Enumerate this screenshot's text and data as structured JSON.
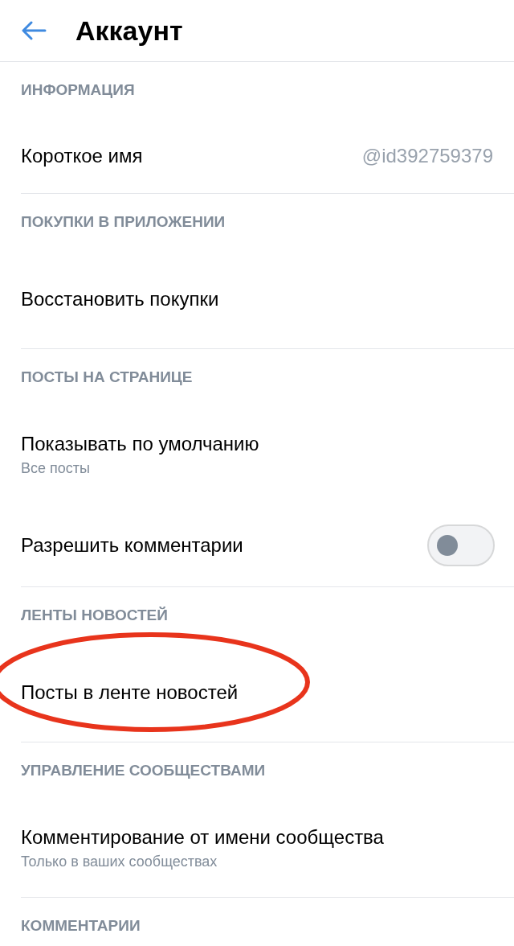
{
  "header": {
    "title": "Аккаунт"
  },
  "sections": [
    {
      "title": "ИНФОРМАЦИЯ",
      "items": [
        {
          "kind": "value",
          "label": "Короткое имя",
          "value": "@id392759379",
          "circled": false
        }
      ]
    },
    {
      "title": "ПОКУПКИ В ПРИЛОЖЕНИИ",
      "items": [
        {
          "kind": "plain",
          "label": "Восстановить покупки",
          "circled": false
        }
      ]
    },
    {
      "title": "ПОСТЫ НА СТРАНИЦЕ",
      "items": [
        {
          "kind": "subtitle",
          "label": "Показывать по умолчанию",
          "subtitle": "Все посты",
          "circled": false
        },
        {
          "kind": "toggle",
          "label": "Разрешить комментарии",
          "on": false,
          "circled": false
        }
      ]
    },
    {
      "title": "ЛЕНТЫ НОВОСТЕЙ",
      "items": [
        {
          "kind": "plain",
          "label": "Посты в ленте новостей",
          "circled": true
        }
      ]
    },
    {
      "title": "УПРАВЛЕНИЕ СООБЩЕСТВАМИ",
      "items": [
        {
          "kind": "subtitle",
          "label": "Комментирование от имени сообщества",
          "subtitle": "Только в ваших сообществах",
          "circled": false
        }
      ]
    },
    {
      "title": "КОММЕНТАРИИ"
    }
  ]
}
